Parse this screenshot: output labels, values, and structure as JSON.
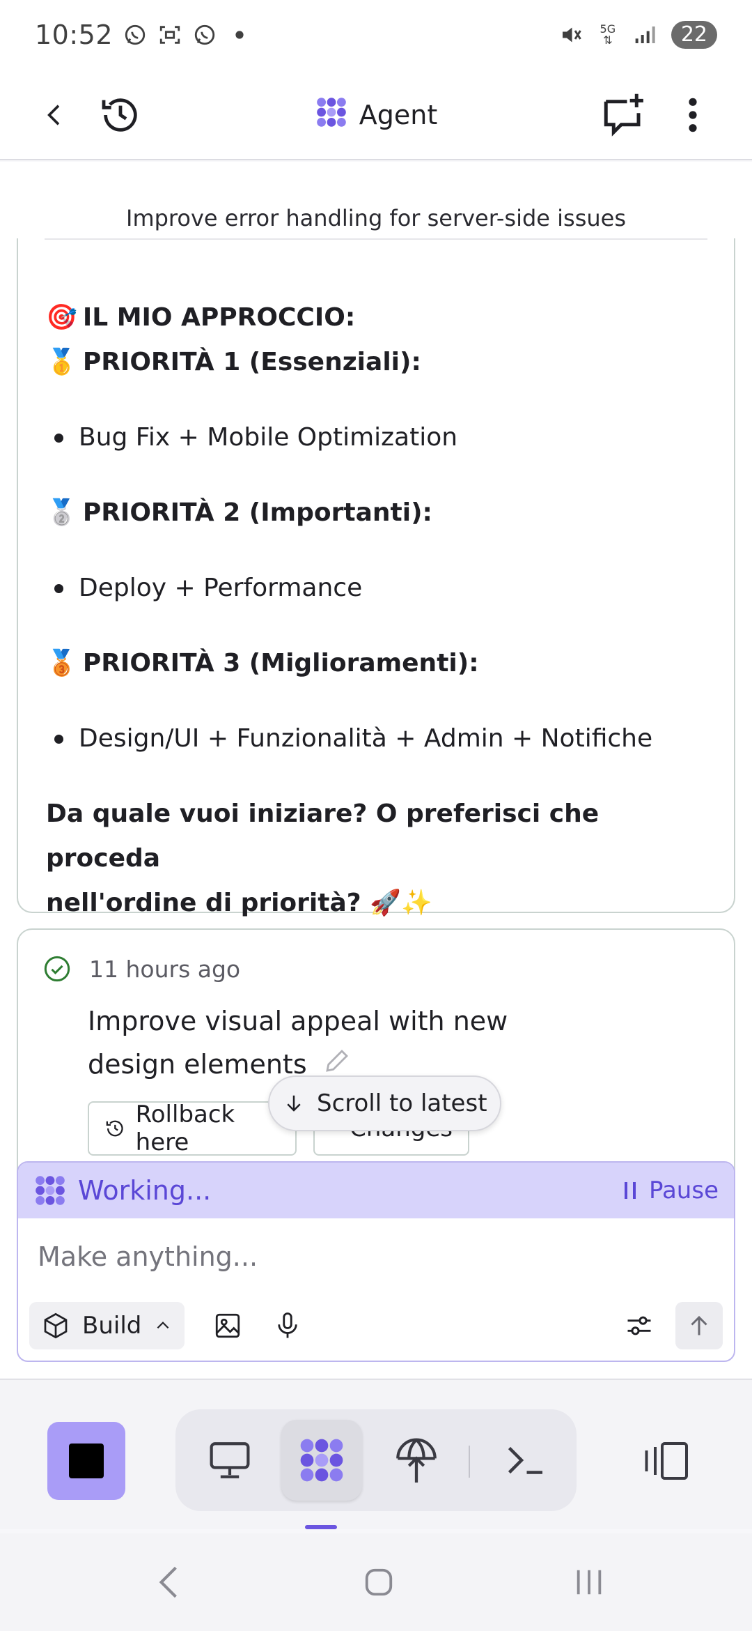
{
  "status_bar": {
    "time": "10:52",
    "network": "5G",
    "battery": "22"
  },
  "app_bar": {
    "title": "Agent",
    "icons": [
      "back-arrow-icon",
      "history-icon",
      "agent-logo-icon",
      "new-chat-icon",
      "more-vert-icon"
    ]
  },
  "chat": {
    "task_title": "Improve error handling for server-side issues",
    "assistant_message": {
      "heading_emoji": "🎯",
      "heading": "IL MIO APPROCCIO:",
      "priorities": [
        {
          "medal": "🥇",
          "title": "PRIORITÀ 1 (Essenziali):",
          "item": "Bug Fix + Mobile Optimization"
        },
        {
          "medal": "🥈",
          "title": "PRIORITÀ 2 (Importanti):",
          "item": "Deploy + Performance"
        },
        {
          "medal": "🥉",
          "title": "PRIORITÀ 3 (Miglioramenti):",
          "item": "Design/UI + Funzionalità + Admin + Notifiche"
        }
      ],
      "question_line1": "Da quale vuoi iniziare? O preferisci che proceda",
      "question_line2": "nell'ordine di priorità? 🚀✨"
    },
    "checkpoint": {
      "time_ago": "11 hours ago",
      "description": "Improve visual appeal with new design elements",
      "rollback_label": "Rollback here",
      "changes_label": "Changes"
    },
    "scroll_to_latest": "Scroll to latest"
  },
  "composer": {
    "status": "Working...",
    "pause_label": "Pause",
    "placeholder": "Make anything...",
    "mode_label": "Build"
  },
  "colors": {
    "accent": "#6b55e0",
    "working_bg": "#d7d3fb",
    "stop_bg": "#a99cf7",
    "success": "#2e7d32"
  }
}
